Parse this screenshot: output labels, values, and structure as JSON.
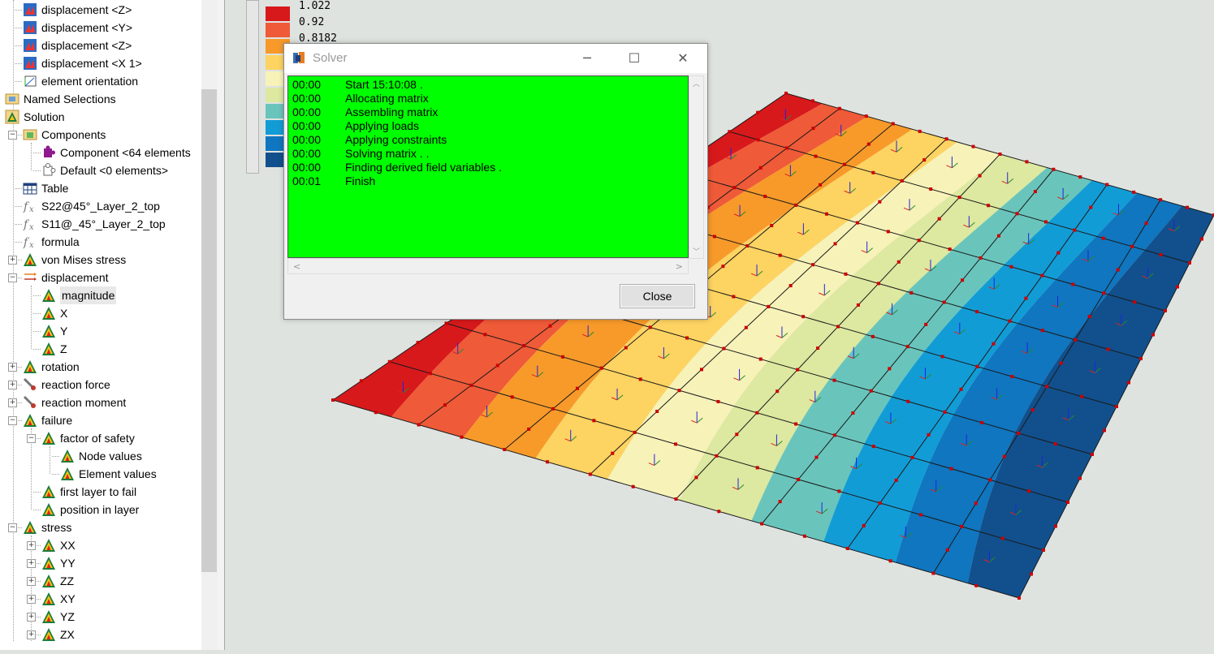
{
  "tree": {
    "items": [
      {
        "label": "displacement <Z>",
        "icon": "displacement-result-icon"
      },
      {
        "label": "displacement <Y>",
        "icon": "displacement-result-icon"
      },
      {
        "label": "displacement <Z>",
        "icon": "displacement-result-icon"
      },
      {
        "label": "displacement <X 1>",
        "icon": "displacement-result-icon"
      },
      {
        "label": "element orientation",
        "icon": "orientation-icon"
      },
      {
        "label": "Named Selections",
        "icon": "named-selections-icon"
      },
      {
        "label": "Solution",
        "icon": "solution-icon"
      },
      {
        "label": "Components",
        "icon": "components-icon"
      },
      {
        "label": "Component <64 elements",
        "icon": "component-icon"
      },
      {
        "label": "Default <0 elements>",
        "icon": "component-default-icon"
      },
      {
        "label": "Table",
        "icon": "table-icon"
      },
      {
        "label": "S22@45°_Layer_2_top",
        "icon": "formula-icon"
      },
      {
        "label": "S11@_45°_Layer_2_top",
        "icon": "formula-icon"
      },
      {
        "label": "formula",
        "icon": "formula-icon"
      },
      {
        "label": "von Mises stress",
        "icon": "result-triangle-icon"
      },
      {
        "label": "displacement",
        "icon": "displacement-arrow-icon"
      },
      {
        "label": "magnitude",
        "icon": "result-triangle-icon"
      },
      {
        "label": "X",
        "icon": "result-triangle-icon"
      },
      {
        "label": "Y",
        "icon": "result-triangle-icon"
      },
      {
        "label": "Z",
        "icon": "result-triangle-icon"
      },
      {
        "label": "rotation",
        "icon": "result-triangle-icon"
      },
      {
        "label": "reaction force",
        "icon": "reaction-icon"
      },
      {
        "label": "reaction moment",
        "icon": "reaction-icon"
      },
      {
        "label": "failure",
        "icon": "result-triangle-icon"
      },
      {
        "label": "factor of safety",
        "icon": "result-triangle-icon"
      },
      {
        "label": "Node values",
        "icon": "result-triangle-icon"
      },
      {
        "label": "Element values",
        "icon": "result-triangle-icon"
      },
      {
        "label": "first layer to fail",
        "icon": "result-triangle-icon"
      },
      {
        "label": "position in layer",
        "icon": "result-triangle-icon"
      },
      {
        "label": "stress",
        "icon": "result-triangle-icon"
      },
      {
        "label": "XX",
        "icon": "result-triangle-icon"
      },
      {
        "label": "YY",
        "icon": "result-triangle-icon"
      },
      {
        "label": "ZZ",
        "icon": "result-triangle-icon"
      },
      {
        "label": "XY",
        "icon": "result-triangle-icon"
      },
      {
        "label": "YZ",
        "icon": "result-triangle-icon"
      },
      {
        "label": "ZX",
        "icon": "result-triangle-icon"
      }
    ]
  },
  "legend": {
    "values": [
      "1.022",
      "0.92",
      "0.8182"
    ],
    "colors": [
      "#d7191c",
      "#ef5a38",
      "#f79a2a",
      "#fdd362",
      "#f7f2b8",
      "#dde8a0",
      "#69c5bc",
      "#129cd6",
      "#0f76bf",
      "#11508d"
    ]
  },
  "solver": {
    "title": "Solver",
    "close_label": "Close",
    "log": [
      {
        "time": "00:00",
        "msg": "Start 15:10:08 ."
      },
      {
        "time": "00:00",
        "msg": "Allocating matrix"
      },
      {
        "time": "00:00",
        "msg": "Assembling matrix"
      },
      {
        "time": "00:00",
        "msg": "Applying loads"
      },
      {
        "time": "00:00",
        "msg": "Applying constraints"
      },
      {
        "time": "00:00",
        "msg": "Solving matrix . ."
      },
      {
        "time": "00:00",
        "msg": "Finding derived field variables ."
      },
      {
        "time": "00:01",
        "msg": "Finish"
      }
    ]
  },
  "colors": {
    "viewport_bg": "#dfe3e0",
    "log_bg": "#00ff00",
    "mesh_line": "#1a1a1a",
    "node_marker": "#cc0000"
  }
}
